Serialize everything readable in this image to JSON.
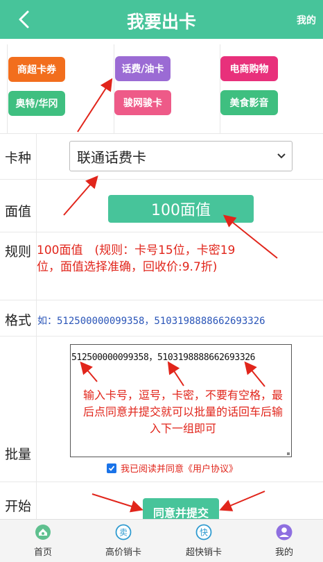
{
  "header": {
    "title": "我要出卡",
    "right_link": "我的",
    "back_icon": "chevron-left-icon"
  },
  "categories": [
    {
      "label": "商超卡券",
      "color": "#f26e1d"
    },
    {
      "label": "话费/油卡",
      "color": "#9b6bd4"
    },
    {
      "label": "电商购物",
      "color": "#e8307b"
    },
    {
      "label": "奥特/华冈",
      "color": "#3fbf80"
    },
    {
      "label": "骏网骏卡",
      "color": "#ee5a88"
    },
    {
      "label": "美食影音",
      "color": "#3fbf80"
    }
  ],
  "form": {
    "card_type_label": "卡种",
    "card_type_value": "联通话费卡",
    "face_value_label": "面值",
    "face_value_button": "100面值",
    "rules_label": "规则",
    "rules_text": "100面值　(规则：卡号15位，卡密19位，面值选择准确，回收价:9.7折)",
    "format_label": "格式",
    "format_text": "如：512500000099358，5103198888662693326",
    "batch_label": "批量",
    "batch_value": "512500000099358，5103198888662693326",
    "batch_hint": "输入卡号，逗号，卡密，不要有空格，最后点同意并提交就可以批量的话回车后输入下一组即可",
    "agree_text": "我已阅读并同意《用户协议》",
    "agree_checked": true,
    "start_label": "开始",
    "submit_label": "同意并提交"
  },
  "tabbar": [
    {
      "label": "首页",
      "icon": "home-icon",
      "glyph": ""
    },
    {
      "label": "高价销卡",
      "icon": "sell-icon",
      "glyph": "卖"
    },
    {
      "label": "超快销卡",
      "icon": "fast-icon",
      "glyph": "快"
    },
    {
      "label": "我的",
      "icon": "user-icon",
      "glyph": ""
    }
  ],
  "colors": {
    "primary": "#47c49a",
    "alert": "#e1251b",
    "format_blue": "#2a55b8"
  }
}
